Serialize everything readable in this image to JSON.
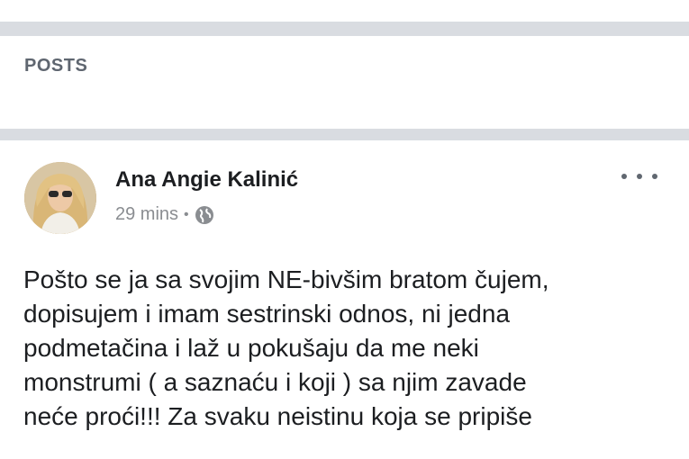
{
  "section": {
    "title": "POSTS"
  },
  "post": {
    "author": "Ana Angie Kalinić",
    "time": "29 mins",
    "separator": "•",
    "privacy_icon": "globe-icon",
    "menu_icon": "more-options-icon",
    "text_lines": [
      "Pošto se ja sa svojim NE-bivšim bratom čujem,",
      "dopisujem i imam sestrinski odnos, ni jedna",
      "podmetačina i laž u pokušaju da me neki",
      "monstrumi ( a saznaću i koji ) sa njim zavade",
      "neće proći!!! Za svaku neistinu koja se pripiše"
    ]
  },
  "colors": {
    "separator_gray": "#d9dce1",
    "text_dark": "#1c1e21",
    "text_meta": "#8a8d91"
  }
}
